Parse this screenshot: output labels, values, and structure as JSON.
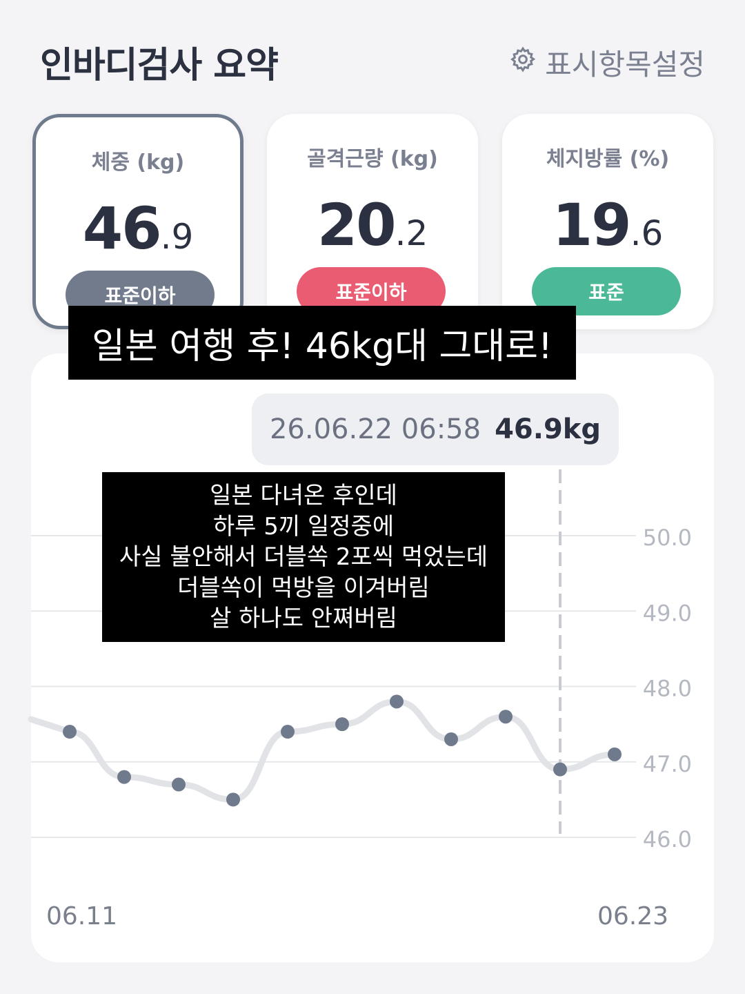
{
  "header": {
    "title": "인바디검사 요약",
    "settings_label": "표시항목설정"
  },
  "cards": [
    {
      "label": "체중 (kg)",
      "int": "46",
      "dec": ".9",
      "badge": "표준이하",
      "badge_color": "#717b8c",
      "selected": true
    },
    {
      "label": "골격근량 (kg)",
      "int": "20",
      "dec": ".2",
      "badge": "표준이하",
      "badge_color": "#ea5c72",
      "selected": false
    },
    {
      "label": "체지방률 (%)",
      "int": "19",
      "dec": ".6",
      "badge": "표준",
      "badge_color": "#4bb898",
      "selected": false
    }
  ],
  "tooltip": {
    "datetime": "26.06.22 06:58",
    "value": "46.9kg"
  },
  "overlay": {
    "caption": "일본 여행 후! 46kg대 그대로!",
    "memo_lines": [
      "일본 다녀온 후인데",
      "하루 5끼 일정중에",
      "사실 불안해서 더블쏙 2포씩 먹었는데",
      "더블쏙이 먹방을 이겨버림",
      "살 하나도 안쪄버림"
    ]
  },
  "chart_data": {
    "type": "line",
    "x_start_label": "06.11",
    "x_end_label": "06.23",
    "ylim": [
      46.0,
      50.0
    ],
    "y_ticks": [
      "50.0",
      "49.0",
      "48.0",
      "47.0",
      "46.0"
    ],
    "points": [
      47.4,
      46.8,
      46.7,
      46.5,
      47.4,
      47.5,
      47.8,
      47.3,
      47.6,
      46.9,
      47.1
    ],
    "selected_index": 9,
    "point_color": "#6f7a8d",
    "line_color": "#e2e3e7"
  }
}
